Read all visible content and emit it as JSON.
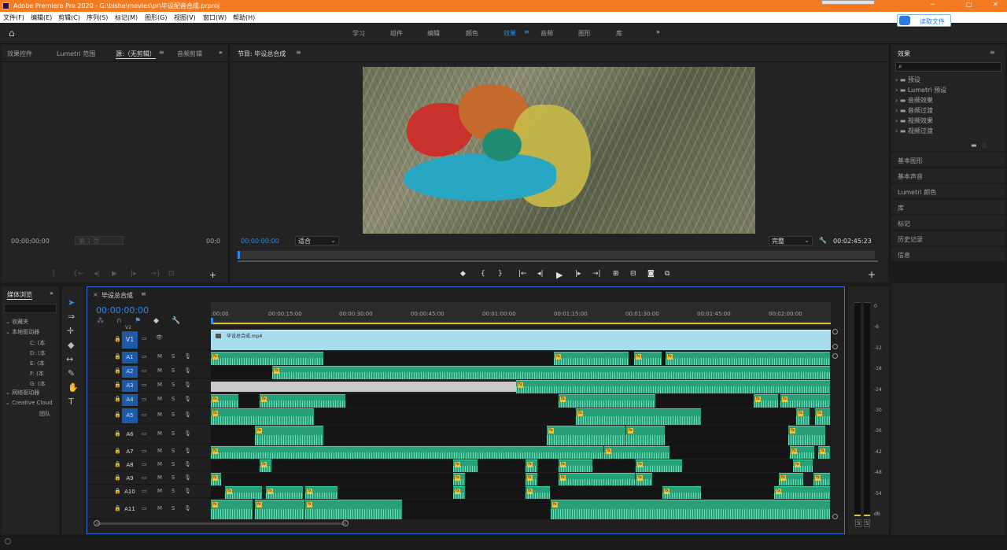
{
  "app": {
    "title": "Adobe Premiere Pro 2020 - G:\\bishe\\movies\\pr\\毕设配音合成.prproj"
  },
  "menu": [
    "文件(F)",
    "编辑(E)",
    "剪辑(C)",
    "序列(S)",
    "标记(M)",
    "图形(G)",
    "视图(V)",
    "窗口(W)",
    "帮助(H)"
  ],
  "workspaces": [
    "学习",
    "组件",
    "编辑",
    "颜色",
    "效果",
    "音频",
    "图形",
    "库"
  ],
  "active_workspace": "效果",
  "cloud_button": "读取文件",
  "source": {
    "tabs": [
      "效果控件",
      "Lumetri 范围",
      "源:（无剪辑）",
      "音频剪辑"
    ],
    "tc_left": "00;00;00;00",
    "page": "第 1 页",
    "tc_right": "00;0"
  },
  "program": {
    "title": "节目: 毕设总合成",
    "timecode": "00:00:00:00",
    "fit": "适合",
    "quality": "完整",
    "duration": "00:02:45:23"
  },
  "effects": {
    "title": "效果",
    "folders": [
      "预设",
      "Lumetri 预设",
      "音频效果",
      "音频过渡",
      "视频效果",
      "视频过渡"
    ],
    "panels": [
      "基本图形",
      "基本声音",
      "Lumetri 颜色",
      "库",
      "标记",
      "历史记录",
      "信息"
    ]
  },
  "media": {
    "tab": "媒体浏览",
    "favorites": "收藏夹",
    "local": "本地驱动器",
    "drives": [
      "C: (本",
      "D: (本",
      "E: (本",
      "F: (本",
      "G: (本"
    ],
    "network": "网络驱动器",
    "cc": "Creative Cloud",
    "team": "团队"
  },
  "timeline": {
    "sequence": "毕设总合成",
    "timecode": "00:00:00:00",
    "ruler": [
      ":00:00",
      "00:00:15:00",
      "00:00:30:00",
      "00:00:45:00",
      "00:01:00:00",
      "00:01:15:00",
      "00:01:30:00",
      "00:01:45:00",
      "00:02:00:00"
    ],
    "video_clip": "毕设总合成.mp4",
    "tracks": [
      "V1",
      "A1",
      "A2",
      "A3",
      "A4",
      "A5",
      "A6",
      "A7",
      "A8",
      "A9",
      "A10",
      "A11"
    ],
    "v_above": "V2"
  },
  "meter": {
    "scale": [
      "0",
      "-6",
      "-12",
      "-18",
      "-24",
      "-30",
      "-36",
      "-42",
      "-48",
      "-54",
      "dB"
    ],
    "solo": [
      "S",
      "S"
    ]
  },
  "icons": [
    "home-icon",
    "selection-tool-icon",
    "track-select-icon",
    "ripple-icon",
    "razor-icon",
    "slip-icon",
    "pen-icon",
    "hand-icon",
    "type-icon",
    "play-icon",
    "wrench-icon",
    "camera-icon"
  ]
}
